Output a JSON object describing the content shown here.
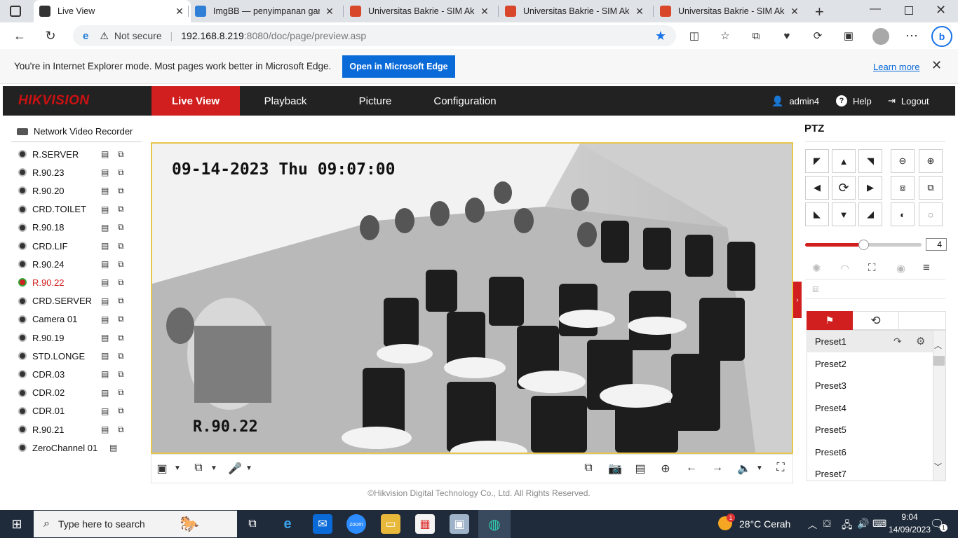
{
  "browser": {
    "tabs": [
      {
        "title": "Live View",
        "favicon": "hik-icon",
        "color": "#333333",
        "active": true
      },
      {
        "title": "ImgBB — penyimpanan gamb",
        "favicon": "imgbb-icon",
        "color": "#2f7fd6",
        "active": false
      },
      {
        "title": "Universitas Bakrie - SIM Akad",
        "favicon": "bakrie-icon",
        "color": "#d9472b",
        "active": false
      },
      {
        "title": "Universitas Bakrie - SIM Akad",
        "favicon": "bakrie-icon",
        "color": "#d9472b",
        "active": false
      },
      {
        "title": "Universitas Bakrie - SIM Akad",
        "favicon": "bakrie-icon",
        "color": "#d9472b",
        "active": false
      }
    ],
    "address": {
      "security": "Not secure",
      "host": "192.168.8.219",
      "rest": ":8080/doc/page/preview.asp"
    },
    "ie_banner": {
      "message": "You're in Internet Explorer mode. Most pages work better in Microsoft Edge.",
      "button": "Open in Microsoft Edge",
      "link": "Learn more"
    }
  },
  "header": {
    "brand": "HIKVISION",
    "nav": [
      "Live View",
      "Playback",
      "Picture",
      "Configuration"
    ],
    "active_nav": "Live View",
    "user": "admin4",
    "help": "Help",
    "logout": "Logout"
  },
  "tree": {
    "root": "Network Video Recorder",
    "cameras": [
      {
        "name": "R.SERVER",
        "active": false
      },
      {
        "name": "R.90.23",
        "active": false
      },
      {
        "name": "R.90.20",
        "active": false
      },
      {
        "name": "CRD.TOILET",
        "active": false
      },
      {
        "name": "R.90.18",
        "active": false
      },
      {
        "name": "CRD.LIF",
        "active": false
      },
      {
        "name": "R.90.24",
        "active": false
      },
      {
        "name": "R.90.22",
        "active": true
      },
      {
        "name": "CRD.SERVER",
        "active": false
      },
      {
        "name": "Camera 01",
        "active": false
      },
      {
        "name": "R.90.19",
        "active": false
      },
      {
        "name": "STD.LONGE",
        "active": false
      },
      {
        "name": "CDR.03",
        "active": false
      },
      {
        "name": "CDR.02",
        "active": false
      },
      {
        "name": "CDR.01",
        "active": false
      },
      {
        "name": "R.90.21",
        "active": false
      },
      {
        "name": "ZeroChannel 01",
        "active": false
      }
    ]
  },
  "video": {
    "osd_time": "09-14-2023 Thu 09:07:00",
    "osd_name": "R.90.22"
  },
  "footer": "©Hikvision Digital Technology Co., Ltd. All Rights Reserved.",
  "ptz": {
    "title": "PTZ",
    "speed": 4,
    "speed_max": 7,
    "presets": [
      "Preset1",
      "Preset2",
      "Preset3",
      "Preset4",
      "Preset5",
      "Preset6",
      "Preset7"
    ]
  },
  "colors": {
    "accent": "#d11f1f",
    "edge_blue": "#0a6ad8",
    "header_bg": "#222222"
  },
  "taskbar": {
    "search_placeholder": "Type here to search",
    "weather": "28°C  Cerah",
    "time": "9:04",
    "date": "14/09/2023",
    "badge": "1"
  }
}
